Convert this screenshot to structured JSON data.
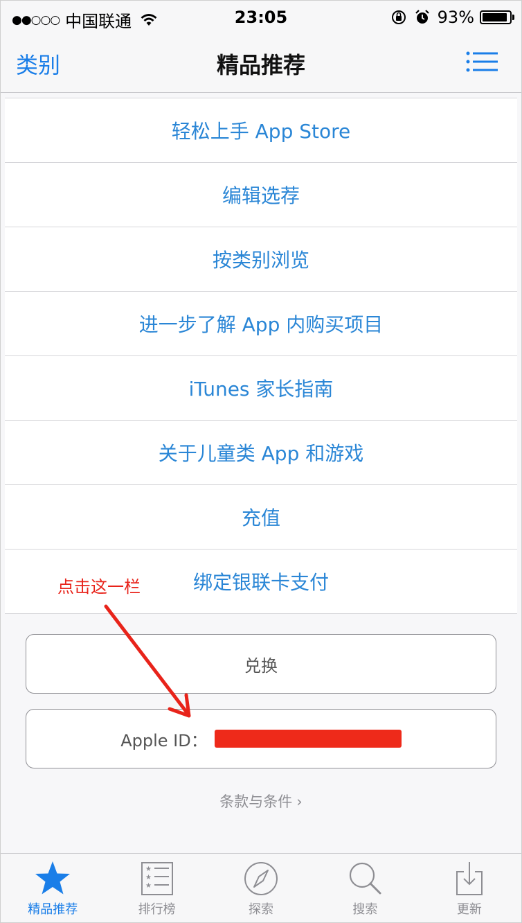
{
  "status_bar": {
    "carrier": "中国联通",
    "signal_dots": "●●○○○",
    "time": "23:05",
    "battery": "93%",
    "battery_level": 0.93
  },
  "nav": {
    "left": "类别",
    "title": "精品推荐",
    "right_icon": "list-icon"
  },
  "list_items": [
    "轻松上手 App Store",
    "编辑选荐",
    "按类别浏览",
    "进一步了解 App 内购买项目",
    "iTunes 家长指南",
    "关于儿童类 App 和游戏",
    "充值",
    "绑定银联卡支付"
  ],
  "buttons": {
    "redeem": "兑换",
    "apple_id_label": "Apple ID："
  },
  "terms": "条款与条件",
  "annotation": "点击这一栏",
  "tabs": [
    {
      "label": "精品推荐",
      "icon": "star-icon",
      "active": true
    },
    {
      "label": "排行榜",
      "icon": "ranking-list-icon",
      "active": false
    },
    {
      "label": "探索",
      "icon": "compass-icon",
      "active": false
    },
    {
      "label": "搜索",
      "icon": "search-icon",
      "active": false
    },
    {
      "label": "更新",
      "icon": "update-download-icon",
      "active": false
    }
  ],
  "colors": {
    "accent": "#1a7ee8",
    "link": "#2a86d6",
    "annotation": "#e8231a"
  }
}
